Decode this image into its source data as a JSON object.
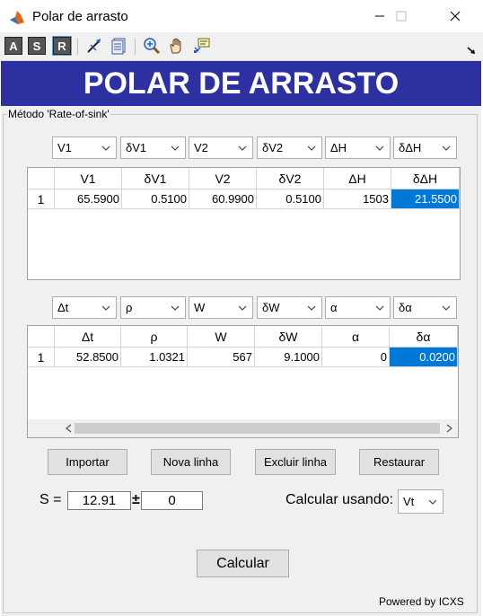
{
  "window": {
    "title": "Polar de arrasto"
  },
  "toolbar": {
    "buttons": [
      {
        "icon": "letter-a-icon",
        "label": "A"
      },
      {
        "icon": "letter-s-icon",
        "label": "S"
      },
      {
        "icon": "letter-r-icon",
        "label": "R"
      },
      {
        "icon": "edit-plot-icon"
      },
      {
        "icon": "property-inspector-icon"
      },
      {
        "icon": "zoom-in-icon"
      },
      {
        "icon": "pan-hand-icon"
      },
      {
        "icon": "data-cursor-icon"
      }
    ]
  },
  "banner": {
    "title": "POLAR DE ARRASTO"
  },
  "panel": {
    "legend": "Método 'Rate-of-sink'"
  },
  "dropdowns1": [
    "V1",
    "δV1",
    "V2",
    "δV2",
    "ΔH",
    "δΔH"
  ],
  "table1": {
    "headers": [
      "V1",
      "δV1",
      "V2",
      "δV2",
      "ΔH",
      "δΔH"
    ],
    "rows": [
      {
        "num": "1",
        "cells": [
          "65.5900",
          "0.5100",
          "60.9900",
          "0.5100",
          "1503",
          "21.5500"
        ]
      }
    ]
  },
  "dropdowns2": [
    "Δt",
    "ρ",
    "W",
    "δW",
    "α",
    "δα"
  ],
  "table2": {
    "headers": [
      "Δt",
      "ρ",
      "W",
      "δW",
      "α",
      "δα"
    ],
    "rows": [
      {
        "num": "1",
        "cells": [
          "52.8500",
          "1.0321",
          "567",
          "9.1000",
          "0",
          "0.0200"
        ]
      }
    ]
  },
  "buttons": {
    "importar": "Importar",
    "nova_linha": "Nova linha",
    "excluir_linha": "Excluir linha",
    "restaurar": "Restaurar",
    "calcular": "Calcular"
  },
  "result": {
    "s_label": "S =",
    "s_value": "12.91",
    "pm": "±",
    "s_error": "0"
  },
  "calc_using": {
    "label": "Calcular usando:",
    "selected": "Vt"
  },
  "footer": {
    "powered_by": "Powered by ICXS"
  },
  "colors": {
    "banner": "#2d30a0",
    "selection": "#0078d7",
    "panel": "#f0f0f0"
  }
}
